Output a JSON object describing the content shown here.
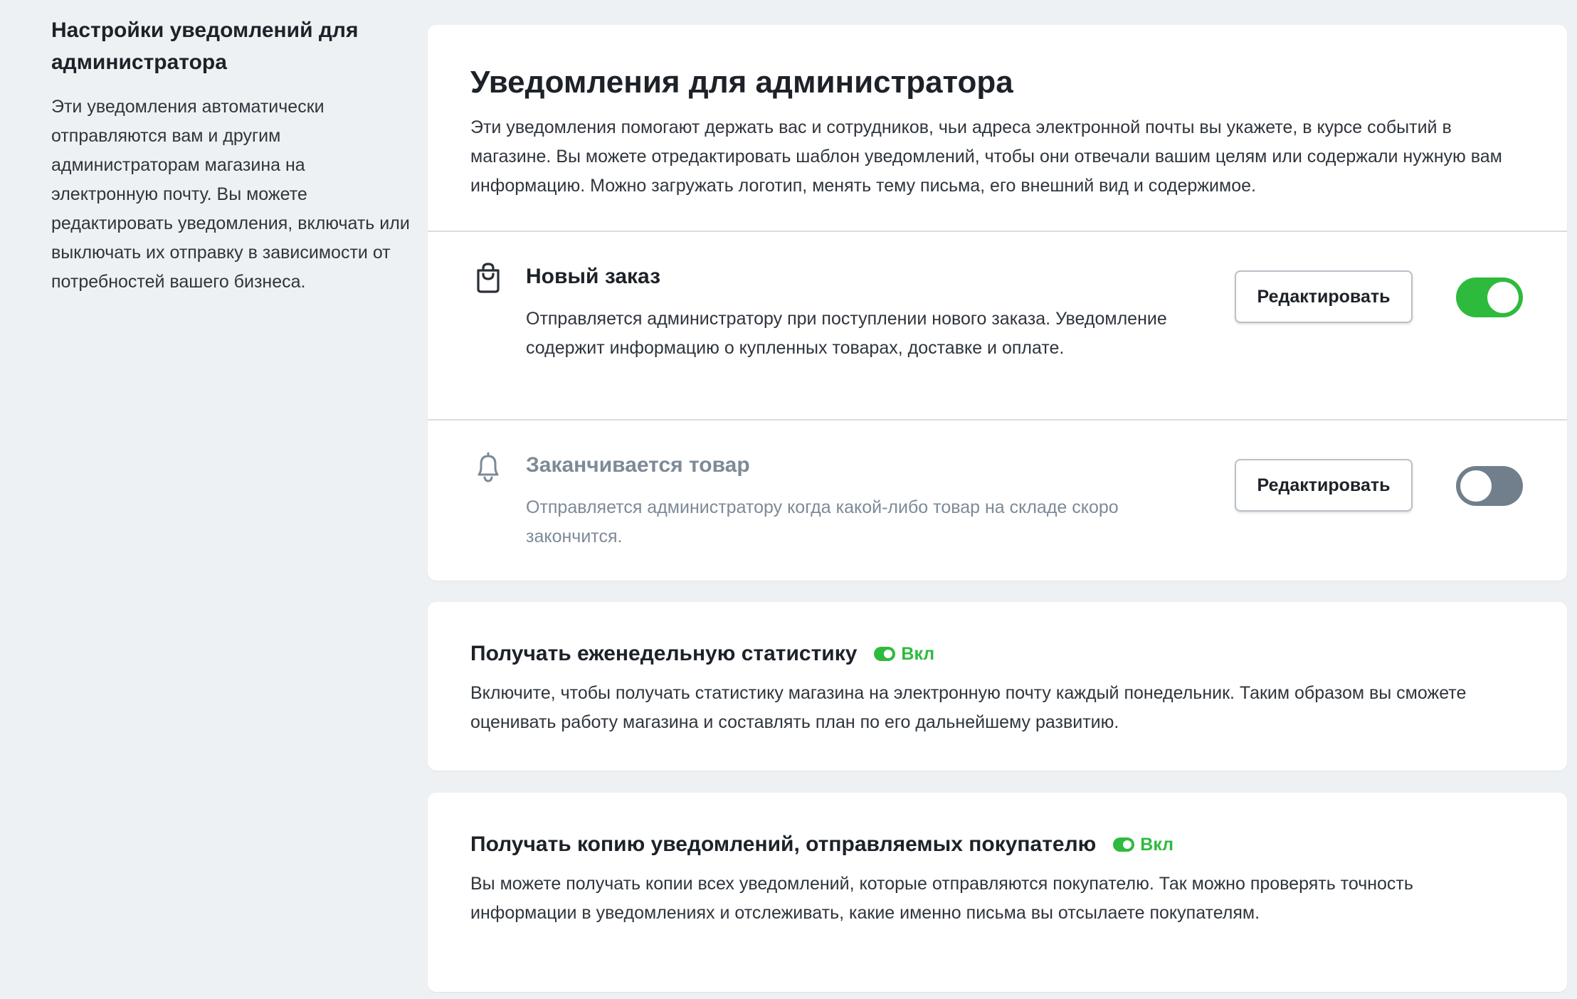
{
  "sidebar": {
    "title": "Настройки уведомлений для администратора",
    "description": "Эти уведомления автоматически отправляются вам и другим администраторам магазина на электронную почту. Вы можете редактировать уведомления, включать или выключать их отправку в зависимости от потребностей вашего бизнеса."
  },
  "main_card": {
    "title": "Уведомления для администратора",
    "description": "Эти уведомления помогают держать вас и сотрудников, чьи адреса электронной почты вы укажете, в курсе событий в магазине. Вы можете отредактировать шаблон уведомлений, чтобы они отвечали вашим целям или содержали нужную вам информацию. Можно загружать логотип, менять тему письма, его внешний вид и содержимое.",
    "notifications": [
      {
        "icon": "shopping-bag-icon",
        "title": "Новый заказ",
        "description": "Отправляется администратору при поступлении нового заказа. Уведомление содержит информацию о купленных товарах, доставке и оплате.",
        "edit_label": "Редактировать",
        "enabled": true
      },
      {
        "icon": "bell-icon",
        "title": "Заканчивается товар",
        "description": "Отправляется администратору когда какой-либо товар на складе скоро закончится.",
        "edit_label": "Редактировать",
        "enabled": false
      }
    ]
  },
  "weekly_stats": {
    "title": "Получать еженедельную статистику",
    "status": "Вкл",
    "description": "Включите, чтобы получать статистику магазина на электронную почту каждый понедельник. Таким образом вы сможете оценивать работу магазина и составлять план по его дальнейшему развитию."
  },
  "customer_copy": {
    "title": "Получать копию уведомлений, отправляемых покупателю",
    "status": "Вкл",
    "description": "Вы можете получать копии всех уведомлений, которые отправляются покупателю. Так можно проверять точность информации в уведомлениях и отслеживать, какие именно письма вы отсылаете покупателям."
  },
  "colors": {
    "accent_green": "#2ebb3d",
    "toggle_off": "#717f8c",
    "muted_text": "#7d8a97",
    "background": "#eef1f4"
  }
}
